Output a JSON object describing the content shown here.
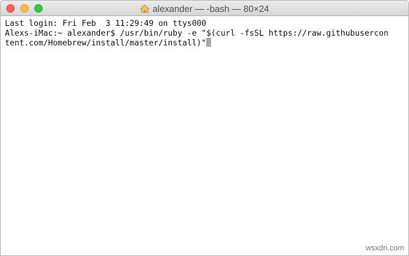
{
  "window": {
    "title": "alexander — -bash — 80×24"
  },
  "terminal": {
    "lines": [
      "Last login: Fri Feb  3 11:29:49 on ttys000",
      "Alexs-iMac:~ alexander$ /usr/bin/ruby -e \"$(curl -fsSL https://raw.githubusercon",
      "tent.com/Homebrew/install/master/install)\""
    ]
  },
  "watermark": "wsxdn.com",
  "colors": {
    "close": "#fc605c",
    "minimize": "#fdbc40",
    "zoom": "#34c84a",
    "cursor": "#a8a8a8"
  },
  "icons": {
    "title": "home-folder-icon"
  }
}
